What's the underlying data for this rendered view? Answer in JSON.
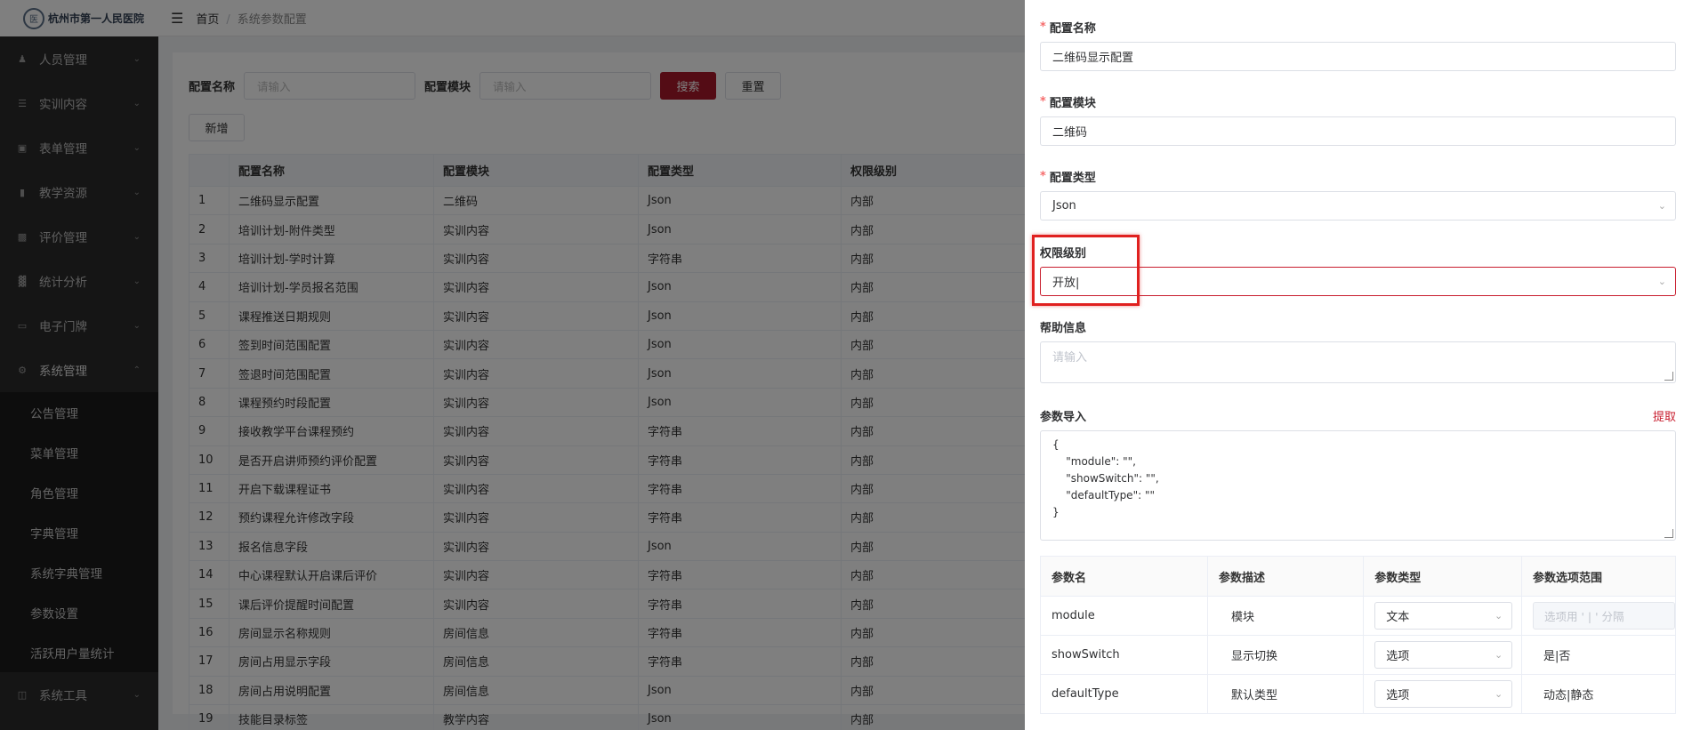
{
  "app": {
    "logo_text": "杭州市第一人民医院",
    "logo_mark": "医"
  },
  "sidebar": {
    "items": [
      {
        "label": "人员管理",
        "icon": "user-icon"
      },
      {
        "label": "实训内容",
        "icon": "list-icon"
      },
      {
        "label": "表单管理",
        "icon": "form-icon"
      },
      {
        "label": "教学资源",
        "icon": "book-icon"
      },
      {
        "label": "评价管理",
        "icon": "rating-icon"
      },
      {
        "label": "统计分析",
        "icon": "chart-icon"
      },
      {
        "label": "电子门牌",
        "icon": "monitor-icon"
      },
      {
        "label": "系统管理",
        "icon": "gear-icon"
      }
    ],
    "sub_items": [
      "公告管理",
      "菜单管理",
      "角色管理",
      "字典管理",
      "系统字典管理",
      "参数设置",
      "活跃用户量统计"
    ],
    "tools": {
      "label": "系统工具",
      "icon": "briefcase-icon"
    }
  },
  "header": {
    "home": "首页",
    "sep": "/",
    "current": "系统参数配置"
  },
  "search": {
    "name_label": "配置名称",
    "name_placeholder": "请输入",
    "module_label": "配置模块",
    "module_placeholder": "请输入",
    "search_btn": "搜索",
    "reset_btn": "重置",
    "add_btn": "新增"
  },
  "table": {
    "headers": [
      "",
      "配置名称",
      "配置模块",
      "配置类型",
      "权限级别"
    ],
    "rows": [
      [
        "1",
        "二维码显示配置",
        "二维码",
        "Json",
        "内部"
      ],
      [
        "2",
        "培训计划-附件类型",
        "实训内容",
        "Json",
        "内部"
      ],
      [
        "3",
        "培训计划-学时计算",
        "实训内容",
        "字符串",
        "内部"
      ],
      [
        "4",
        "培训计划-学员报名范围",
        "实训内容",
        "Json",
        "内部"
      ],
      [
        "5",
        "课程推送日期规则",
        "实训内容",
        "Json",
        "内部"
      ],
      [
        "6",
        "签到时间范围配置",
        "实训内容",
        "Json",
        "内部"
      ],
      [
        "7",
        "签退时间范围配置",
        "实训内容",
        "Json",
        "内部"
      ],
      [
        "8",
        "课程预约时段配置",
        "实训内容",
        "Json",
        "内部"
      ],
      [
        "9",
        "接收教学平台课程预约",
        "实训内容",
        "字符串",
        "内部"
      ],
      [
        "10",
        "是否开启讲师预约评价配置",
        "实训内容",
        "字符串",
        "内部"
      ],
      [
        "11",
        "开启下载课程证书",
        "实训内容",
        "字符串",
        "内部"
      ],
      [
        "12",
        "预约课程允许修改字段",
        "实训内容",
        "字符串",
        "内部"
      ],
      [
        "13",
        "报名信息字段",
        "实训内容",
        "Json",
        "内部"
      ],
      [
        "14",
        "中心课程默认开启课后评价",
        "实训内容",
        "字符串",
        "内部"
      ],
      [
        "15",
        "课后评价提醒时间配置",
        "实训内容",
        "字符串",
        "内部"
      ],
      [
        "16",
        "房间显示名称规则",
        "房间信息",
        "字符串",
        "内部"
      ],
      [
        "17",
        "房间占用显示字段",
        "房间信息",
        "字符串",
        "内部"
      ],
      [
        "18",
        "房间占用说明配置",
        "房间信息",
        "Json",
        "内部"
      ],
      [
        "19",
        "技能目录标签",
        "教学内容",
        "Json",
        "内部"
      ]
    ]
  },
  "drawer": {
    "name_label": "配置名称",
    "name_value": "二维码显示配置",
    "module_label": "配置模块",
    "module_value": "二维码",
    "type_label": "配置类型",
    "type_value": "Json",
    "level_label": "权限级别",
    "level_value": "开放|",
    "help_label": "帮助信息",
    "help_placeholder": "请输入",
    "import_label": "参数导入",
    "extract": "提取",
    "import_code": "{\n    \"module\": \"\",\n    \"showSwitch\": \"\",\n    \"defaultType\": \"\"\n}",
    "params_headers": [
      "参数名",
      "参数描述",
      "参数类型",
      "参数选项范围"
    ],
    "params": [
      {
        "name": "module",
        "desc": "模块",
        "type": "文本",
        "range": "",
        "range_placeholder": "选项用 ' | ' 分隔"
      },
      {
        "name": "showSwitch",
        "desc": "显示切换",
        "type": "选项",
        "range": "是|否"
      },
      {
        "name": "defaultType",
        "desc": "默认类型",
        "type": "选项",
        "range": "动态|静态"
      }
    ]
  },
  "colors": {
    "primary": "#a8192a",
    "highlight": "#e0201f",
    "sidebar": "#2b2b2b"
  }
}
